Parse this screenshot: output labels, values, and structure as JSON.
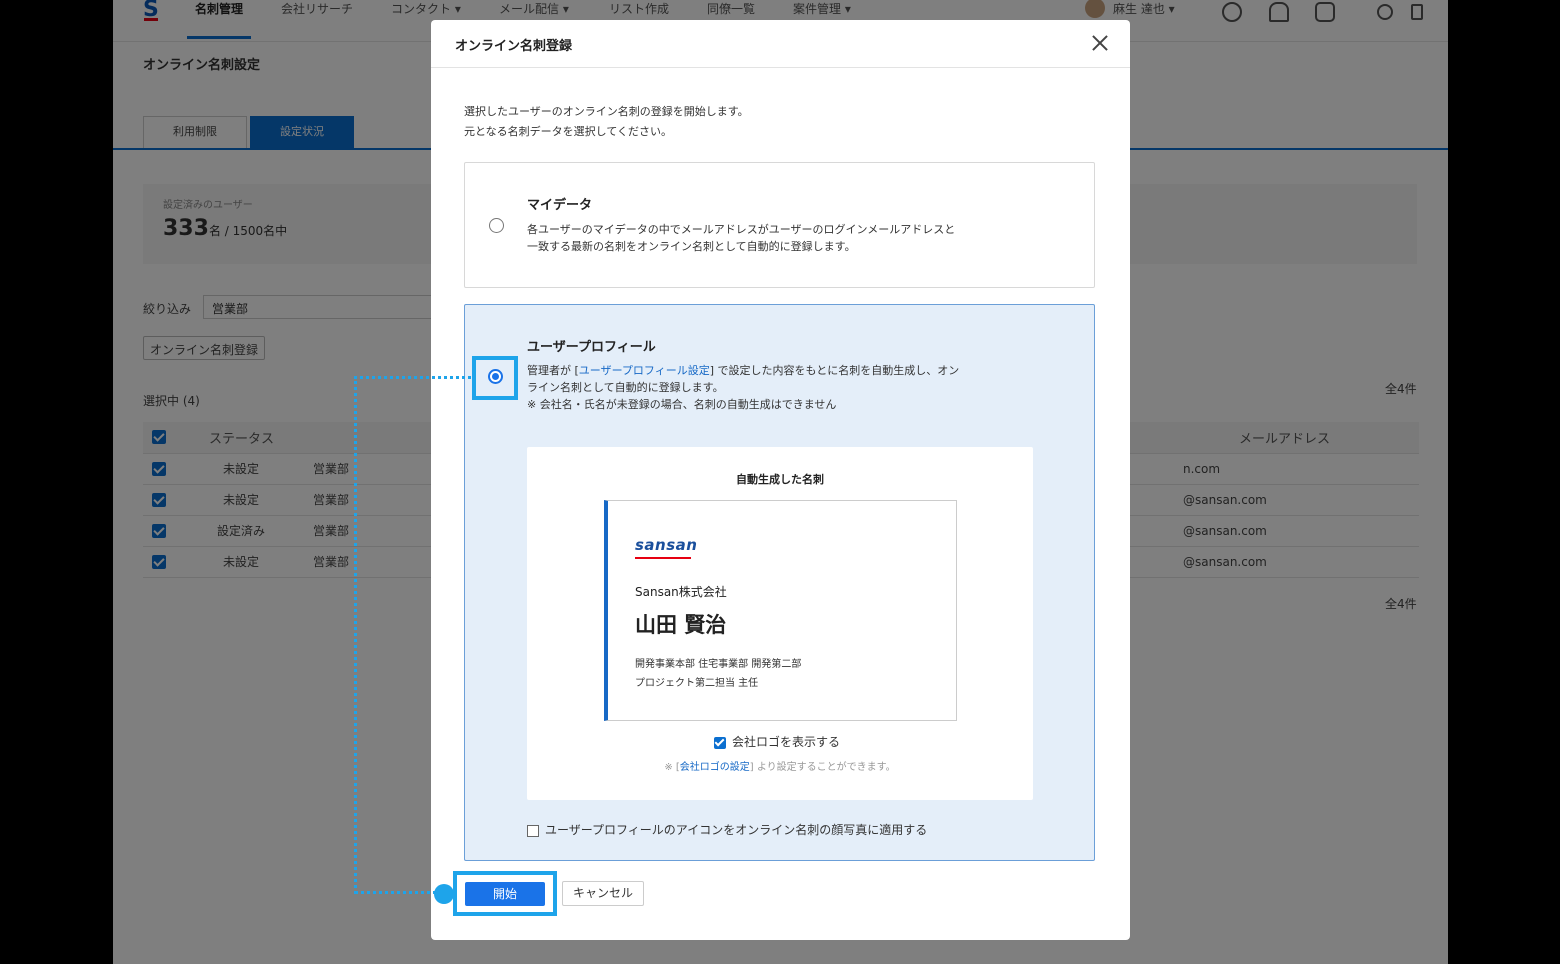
{
  "app": {
    "logo": "S",
    "nav": [
      "名刺管理",
      "会社リサーチ",
      "コンタクト ▾",
      "メール配信 ▾",
      "リスト作成",
      "同僚一覧",
      "案件管理 ▾"
    ],
    "user": "麻生 達也 ▾",
    "page_title": "オンライン名刺設定",
    "tabs": [
      "利用制限",
      "設定状況"
    ],
    "stat": {
      "label": "設定済みのユーザー",
      "count": "333",
      "suffix": "名 / 1500名中"
    },
    "filter": {
      "label": "絞り込み",
      "value": "営業部"
    },
    "register_button": "オンライン名刺登録",
    "selected": "選択中 (4)",
    "total": "全4件",
    "table": {
      "headers": {
        "status": "ステータス",
        "email": "メールアドレス"
      },
      "rows": [
        {
          "status": "未設定",
          "dept": "営業部",
          "email": "n.com",
          "unset": true
        },
        {
          "status": "未設定",
          "dept": "営業部",
          "email": "@sansan.com",
          "unset": true
        },
        {
          "status": "設定済み",
          "dept": "営業部",
          "email": "@sansan.com",
          "unset": false
        },
        {
          "status": "未設定",
          "dept": "営業部",
          "email": "@sansan.com",
          "unset": true
        }
      ]
    }
  },
  "modal": {
    "title": "オンライン名刺登録",
    "intro_line1": "選択したユーザーのオンライン名刺の登録を開始します。",
    "intro_line2": "元となる名刺データを選択してください。",
    "option1": {
      "title": "マイデータ",
      "desc_line1": "各ユーザーのマイデータの中でメールアドレスがユーザーのログインメールアドレスと",
      "desc_line2": "一致する最新の名刺をオンライン名刺として自動的に登録します。"
    },
    "option2": {
      "title": "ユーザープロフィール",
      "desc_pre": "管理者が [",
      "desc_link": "ユーザープロフィール設定",
      "desc_post": "] で設定した内容をもとに名刺を自動生成し、オン",
      "desc_line2": "ライン名刺として自動的に登録します。",
      "desc_note": "※ 会社名・氏名が未登録の場合、名刺の自動生成はできません"
    },
    "card": {
      "title": "自動生成した名刺",
      "brand": "sansan",
      "company": "Sansan株式会社",
      "name": "山田 賢治",
      "dept_line1": "開発事業本部 住宅事業部 開発第二部",
      "dept_line2": "プロジェクト第二担当 主任",
      "logo_checkbox": "会社ロゴを表示する",
      "note_pre": "※ [",
      "note_link": "会社ロゴの設定",
      "note_post": "] より設定することができます。"
    },
    "icon_checkbox": "ユーザープロフィールのアイコンをオンライン名刺の顔写真に適用する",
    "start_button": "開始",
    "cancel_button": "キャンセル"
  },
  "colors": {
    "accent": "#1a73e8",
    "highlight": "#1ea4ea",
    "selected_bg": "#e4eef9"
  }
}
